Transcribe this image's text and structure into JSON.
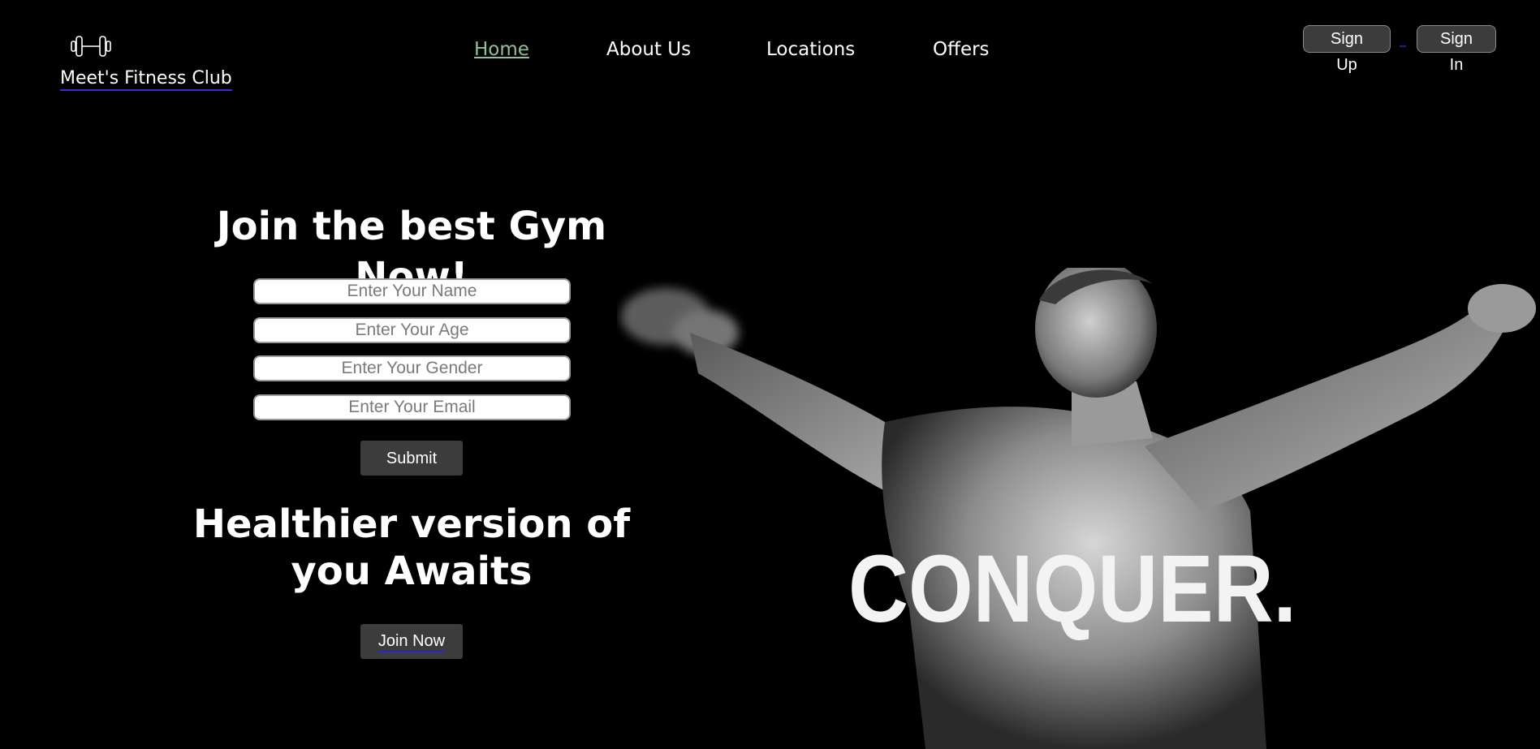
{
  "brand": {
    "name": "Meet's Fitness Club",
    "icon": "dumbbell-icon"
  },
  "nav": {
    "items": [
      {
        "label": "Home",
        "active": true
      },
      {
        "label": "About Us",
        "active": false
      },
      {
        "label": "Locations",
        "active": false
      },
      {
        "label": "Offers",
        "active": false
      }
    ],
    "active_color": "#8fc09a"
  },
  "auth": {
    "signup_label": "Sign Up",
    "signin_label": "Sign In"
  },
  "form": {
    "headline": "Join the best Gym Now!",
    "name_placeholder": "Enter Your Name",
    "age_placeholder": "Enter Your Age",
    "gender_placeholder": "Enter Your Gender",
    "email_placeholder": "Enter Your Email",
    "submit_label": "Submit"
  },
  "promo": {
    "headline": "Healthier version of you Awaits",
    "join_label": "Join Now"
  },
  "hero": {
    "caption": "CONQUER."
  },
  "colors": {
    "background": "#000000",
    "button": "#3c3c3c"
  }
}
